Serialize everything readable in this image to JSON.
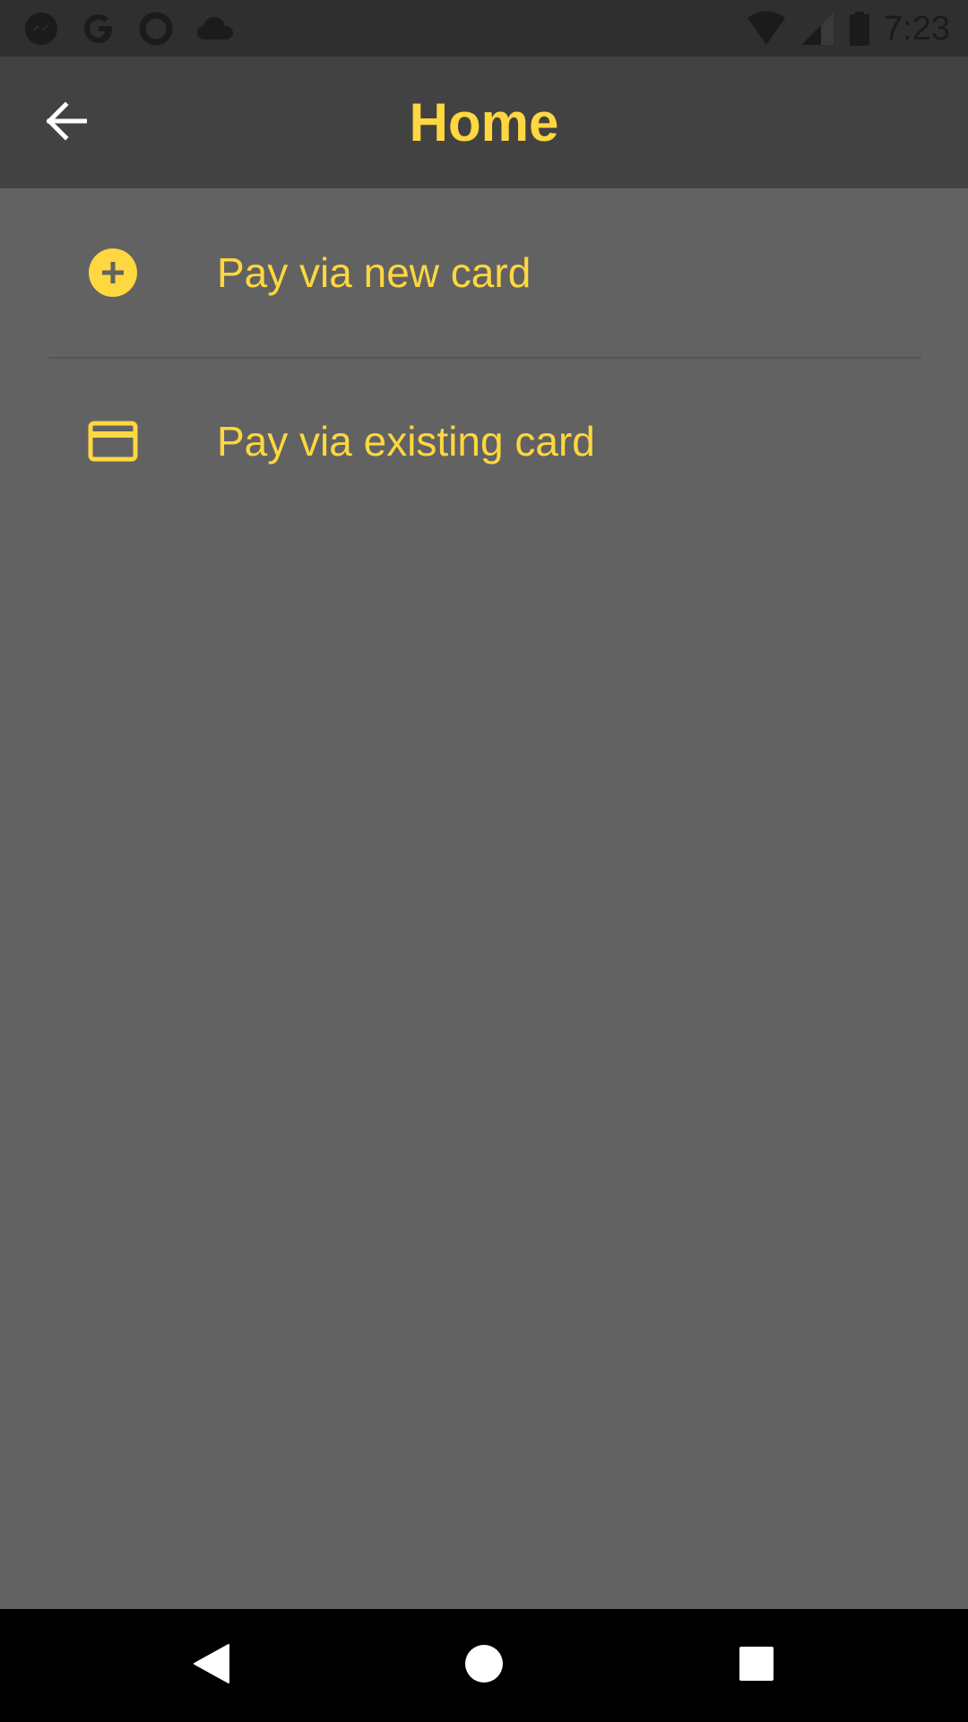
{
  "status_bar": {
    "time": "7:23",
    "left_icons": [
      "messenger-icon",
      "google-icon",
      "circle-app-icon",
      "cloud-icon"
    ],
    "right_icons": [
      "wifi-icon",
      "cell-signal-icon",
      "battery-icon"
    ]
  },
  "app_bar": {
    "title": "Home",
    "back_icon": "arrow-back-icon"
  },
  "options": [
    {
      "label": "Pay via new card",
      "icon": "add-circle-icon"
    },
    {
      "label": "Pay via existing card",
      "icon": "credit-card-icon"
    }
  ],
  "nav_bar": {
    "buttons": [
      "nav-back-icon",
      "nav-home-icon",
      "nav-recents-icon"
    ]
  },
  "colors": {
    "accent": "#ffd740",
    "background": "#626262",
    "app_bar": "#424242",
    "status_bar": "#2f2f2f",
    "nav_bar": "#000000"
  }
}
